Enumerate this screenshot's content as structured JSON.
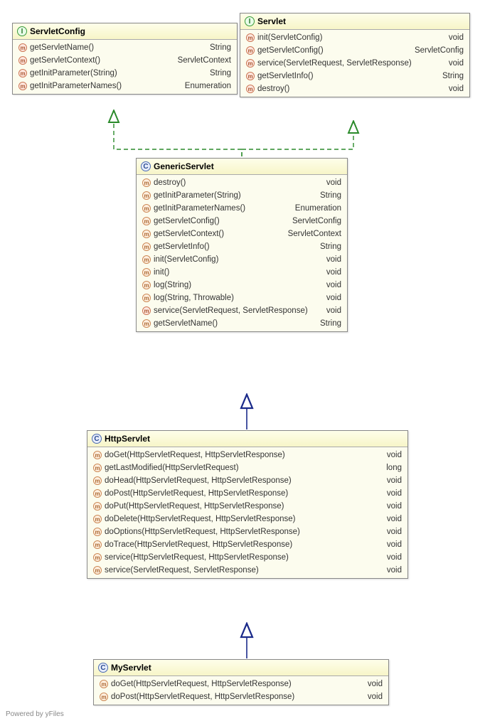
{
  "classes": {
    "servletConfig": {
      "name": "ServletConfig",
      "kind": "interface",
      "methods": [
        {
          "name": "getServletName()",
          "ret": "String",
          "icon": "abstract"
        },
        {
          "name": "getServletContext()",
          "ret": "ServletContext",
          "icon": "abstract"
        },
        {
          "name": "getInitParameter(String)",
          "ret": "String",
          "icon": "abstract"
        },
        {
          "name": "getInitParameterNames()",
          "ret": "Enumeration",
          "icon": "abstract"
        }
      ]
    },
    "servlet": {
      "name": "Servlet",
      "kind": "interface",
      "methods": [
        {
          "name": "init(ServletConfig)",
          "ret": "void",
          "icon": "abstract"
        },
        {
          "name": "getServletConfig()",
          "ret": "ServletConfig",
          "icon": "abstract"
        },
        {
          "name": "service(ServletRequest, ServletResponse)",
          "ret": "void",
          "icon": "abstract"
        },
        {
          "name": "getServletInfo()",
          "ret": "String",
          "icon": "abstract"
        },
        {
          "name": "destroy()",
          "ret": "void",
          "icon": "abstract"
        }
      ]
    },
    "genericServlet": {
      "name": "GenericServlet",
      "kind": "class",
      "methods": [
        {
          "name": "destroy()",
          "ret": "void",
          "icon": "public"
        },
        {
          "name": "getInitParameter(String)",
          "ret": "String",
          "icon": "public"
        },
        {
          "name": "getInitParameterNames()",
          "ret": "Enumeration",
          "icon": "public"
        },
        {
          "name": "getServletConfig()",
          "ret": "ServletConfig",
          "icon": "public"
        },
        {
          "name": "getServletContext()",
          "ret": "ServletContext",
          "icon": "public"
        },
        {
          "name": "getServletInfo()",
          "ret": "String",
          "icon": "public"
        },
        {
          "name": "init(ServletConfig)",
          "ret": "void",
          "icon": "public"
        },
        {
          "name": "init()",
          "ret": "void",
          "icon": "public"
        },
        {
          "name": "log(String)",
          "ret": "void",
          "icon": "public"
        },
        {
          "name": "log(String, Throwable)",
          "ret": "void",
          "icon": "public"
        },
        {
          "name": "service(ServletRequest, ServletResponse)",
          "ret": "void",
          "icon": "abstract"
        },
        {
          "name": "getServletName()",
          "ret": "String",
          "icon": "public"
        }
      ]
    },
    "httpServlet": {
      "name": "HttpServlet",
      "kind": "class",
      "methods": [
        {
          "name": "doGet(HttpServletRequest, HttpServletResponse)",
          "ret": "void",
          "icon": "public"
        },
        {
          "name": "getLastModified(HttpServletRequest)",
          "ret": "long",
          "icon": "public"
        },
        {
          "name": "doHead(HttpServletRequest, HttpServletResponse)",
          "ret": "void",
          "icon": "public"
        },
        {
          "name": "doPost(HttpServletRequest, HttpServletResponse)",
          "ret": "void",
          "icon": "public"
        },
        {
          "name": "doPut(HttpServletRequest, HttpServletResponse)",
          "ret": "void",
          "icon": "public"
        },
        {
          "name": "doDelete(HttpServletRequest, HttpServletResponse)",
          "ret": "void",
          "icon": "public"
        },
        {
          "name": "doOptions(HttpServletRequest, HttpServletResponse)",
          "ret": "void",
          "icon": "public"
        },
        {
          "name": "doTrace(HttpServletRequest, HttpServletResponse)",
          "ret": "void",
          "icon": "public"
        },
        {
          "name": "service(HttpServletRequest, HttpServletResponse)",
          "ret": "void",
          "icon": "public"
        },
        {
          "name": "service(ServletRequest, ServletResponse)",
          "ret": "void",
          "icon": "public"
        }
      ]
    },
    "myServlet": {
      "name": "MyServlet",
      "kind": "class",
      "methods": [
        {
          "name": "doGet(HttpServletRequest, HttpServletResponse)",
          "ret": "void",
          "icon": "public"
        },
        {
          "name": "doPost(HttpServletRequest, HttpServletResponse)",
          "ret": "void",
          "icon": "public"
        }
      ]
    }
  },
  "footer": "Powered by yFiles",
  "colors": {
    "realizationStroke": "#2a8a2a",
    "generalizationStroke": "#1a2a8a"
  }
}
